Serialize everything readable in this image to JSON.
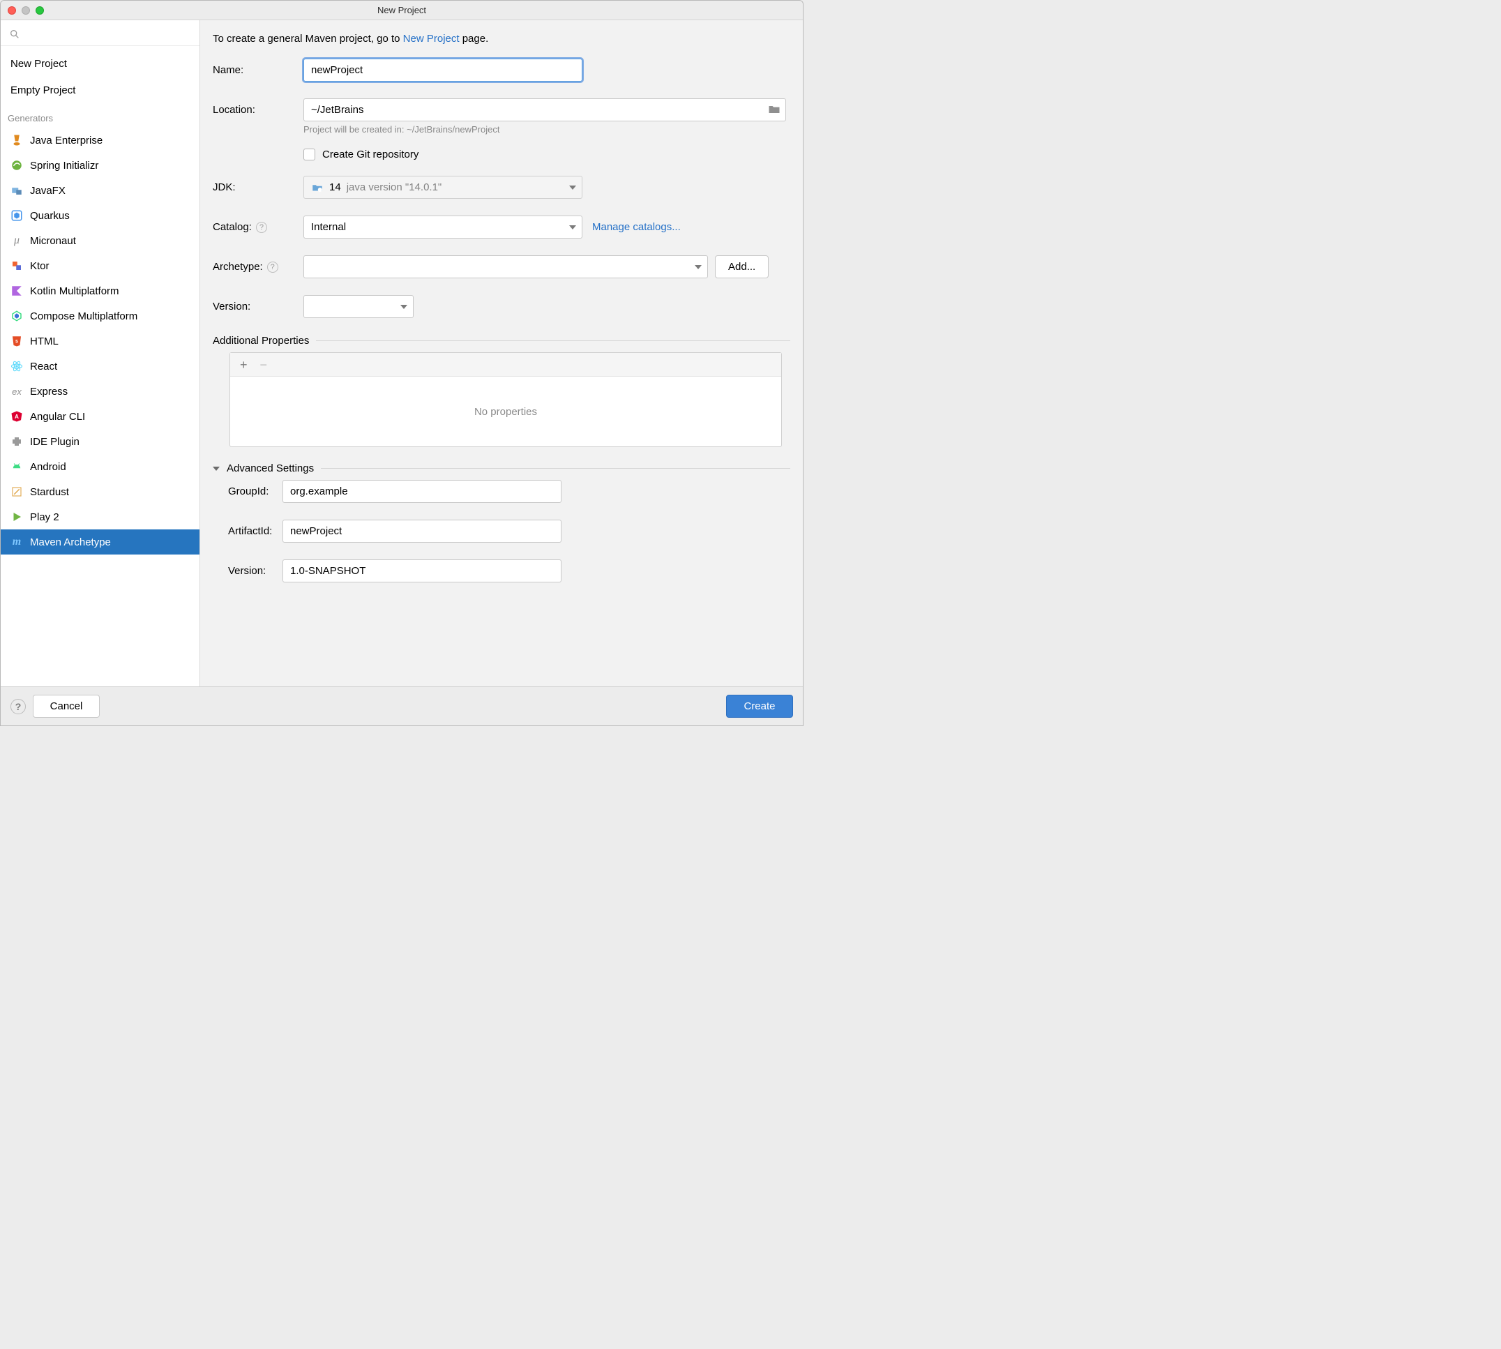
{
  "window": {
    "title": "New Project"
  },
  "sidebar": {
    "search_placeholder": "",
    "top": [
      {
        "label": "New Project"
      },
      {
        "label": "Empty Project"
      }
    ],
    "generators_header": "Generators",
    "generators": [
      {
        "label": "Java Enterprise",
        "icon": "java-ee-icon"
      },
      {
        "label": "Spring Initializr",
        "icon": "spring-icon"
      },
      {
        "label": "JavaFX",
        "icon": "javafx-icon"
      },
      {
        "label": "Quarkus",
        "icon": "quarkus-icon"
      },
      {
        "label": "Micronaut",
        "icon": "micronaut-icon"
      },
      {
        "label": "Ktor",
        "icon": "ktor-icon"
      },
      {
        "label": "Kotlin Multiplatform",
        "icon": "kotlin-icon"
      },
      {
        "label": "Compose Multiplatform",
        "icon": "compose-icon"
      },
      {
        "label": "HTML",
        "icon": "html5-icon"
      },
      {
        "label": "React",
        "icon": "react-icon"
      },
      {
        "label": "Express",
        "icon": "express-icon"
      },
      {
        "label": "Angular CLI",
        "icon": "angular-icon"
      },
      {
        "label": "IDE Plugin",
        "icon": "plugin-icon"
      },
      {
        "label": "Android",
        "icon": "android-icon"
      },
      {
        "label": "Stardust",
        "icon": "stardust-icon"
      },
      {
        "label": "Play 2",
        "icon": "play-icon"
      },
      {
        "label": "Maven Archetype",
        "icon": "maven-icon",
        "selected": true
      }
    ]
  },
  "form": {
    "intro_prefix": "To create a general Maven project, go to ",
    "intro_link": "New Project",
    "intro_suffix": " page.",
    "name_label": "Name:",
    "name_value": "newProject",
    "location_label": "Location:",
    "location_value": "~/JetBrains",
    "location_hint": "Project will be created in: ~/JetBrains/newProject",
    "git_label": "Create Git repository",
    "git_checked": false,
    "jdk_label": "JDK:",
    "jdk_value": "14",
    "jdk_version_detail": "java version \"14.0.1\"",
    "catalog_label": "Catalog:",
    "catalog_value": "Internal",
    "manage_catalogs": "Manage catalogs...",
    "archetype_label": "Archetype:",
    "archetype_value": "",
    "archetype_add": "Add...",
    "version_label": "Version:",
    "version_value": "",
    "additional_props_header": "Additional Properties",
    "no_properties": "No properties",
    "advanced_header": "Advanced Settings",
    "groupid_label": "GroupId:",
    "groupid_value": "org.example",
    "artifactid_label": "ArtifactId:",
    "artifactid_value": "newProject",
    "adv_version_label": "Version:",
    "adv_version_value": "1.0-SNAPSHOT"
  },
  "footer": {
    "cancel": "Cancel",
    "create": "Create"
  }
}
